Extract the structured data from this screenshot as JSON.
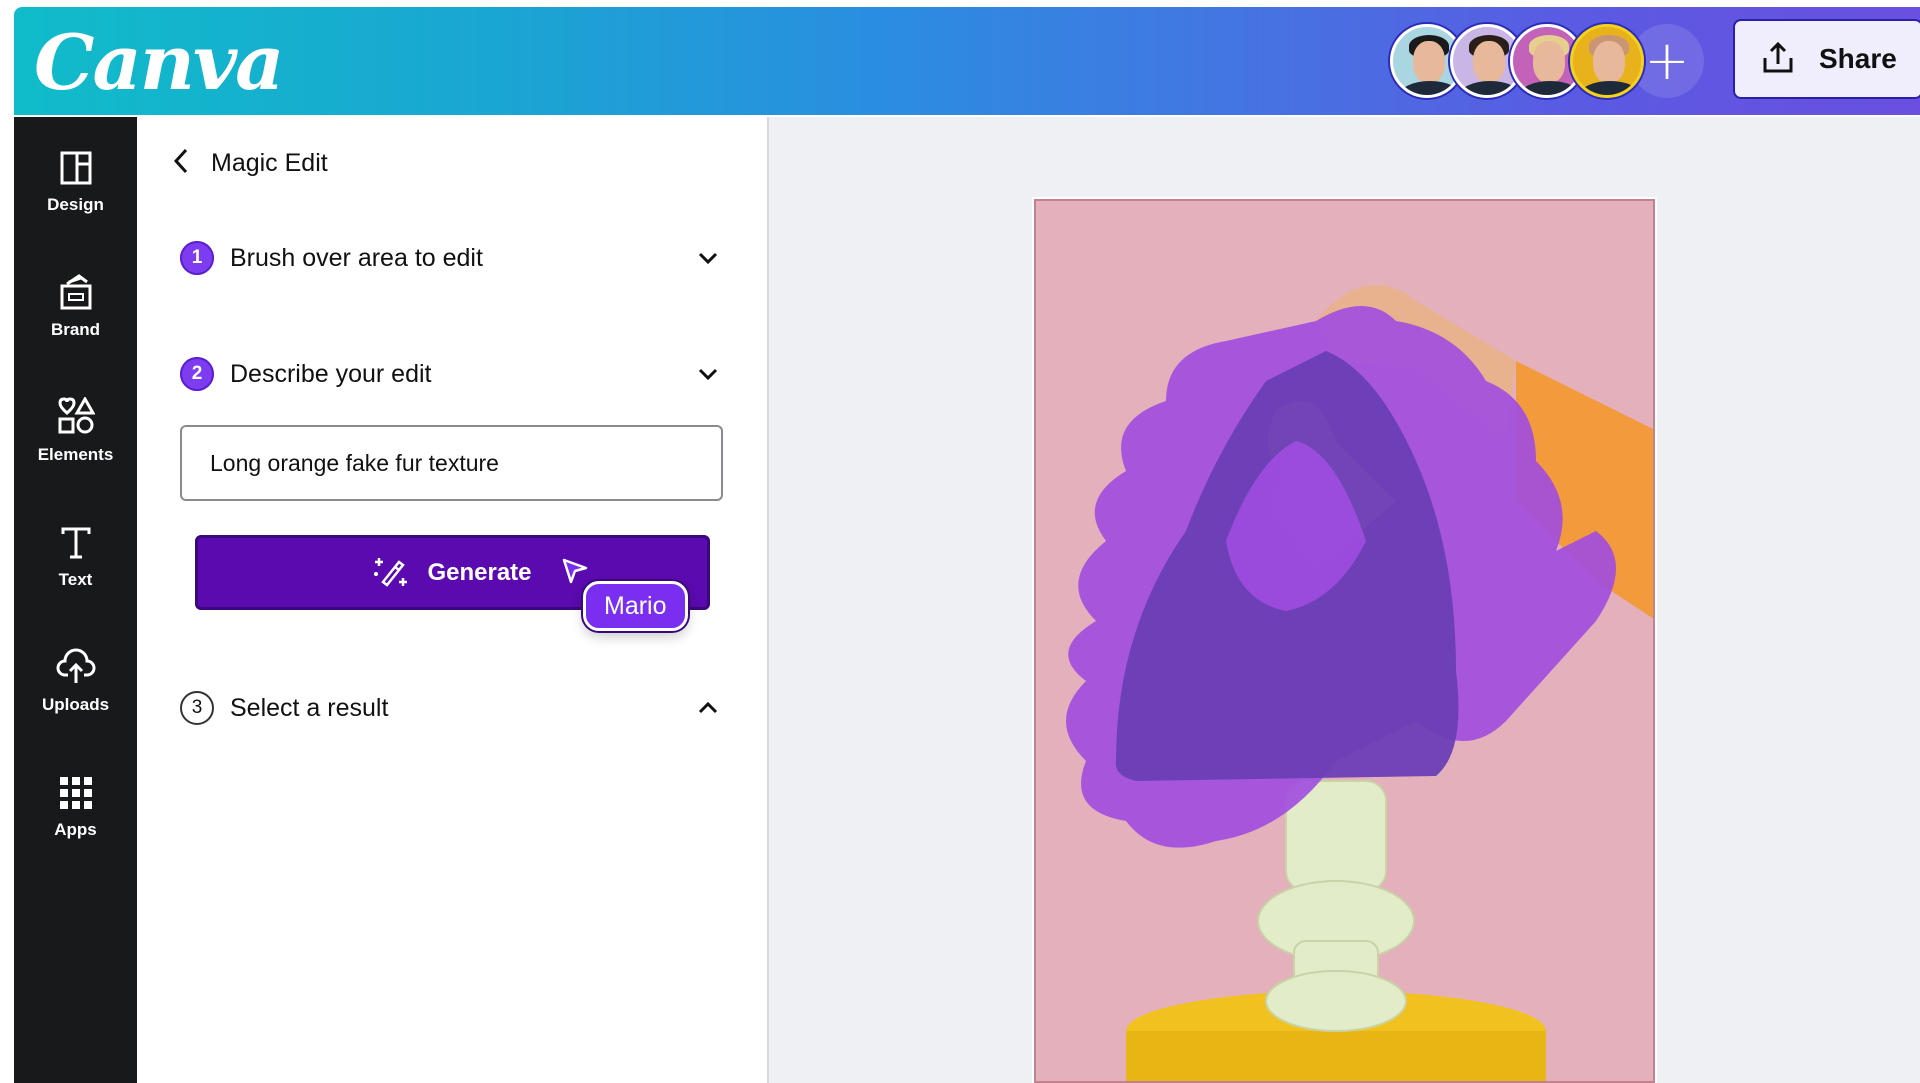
{
  "app": {
    "logo_text": "Canva"
  },
  "header": {
    "collaborators": [
      {
        "name": "collaborator-1",
        "bg": "#a9d6e0",
        "hair": "#1a1a1a",
        "ring": "#ffffff"
      },
      {
        "name": "collaborator-2",
        "bg": "#c9b6e6",
        "hair": "#2a1e18",
        "ring": "#ffffff"
      },
      {
        "name": "collaborator-3",
        "bg": "#c262b8",
        "hair": "#e6cf8e",
        "ring": "#ffffff"
      },
      {
        "name": "collaborator-4",
        "bg": "#e7b21c",
        "hair": "#c99574",
        "ring": "#f5d21a"
      }
    ],
    "add_collaborator_symbol": "+",
    "share_label": "Share"
  },
  "sidebar": {
    "items": [
      {
        "id": "design",
        "label": "Design",
        "icon": "layout-icon"
      },
      {
        "id": "brand",
        "label": "Brand",
        "icon": "brand-kit-icon"
      },
      {
        "id": "elements",
        "label": "Elements",
        "icon": "shapes-icon"
      },
      {
        "id": "text",
        "label": "Text",
        "icon": "text-icon"
      },
      {
        "id": "uploads",
        "label": "Uploads",
        "icon": "cloud-upload-icon"
      },
      {
        "id": "apps",
        "label": "Apps",
        "icon": "apps-grid-icon"
      }
    ]
  },
  "panel": {
    "title": "Magic Edit",
    "steps": [
      {
        "number": "1",
        "label": "Brush over area to edit",
        "state": "active",
        "expanded": false
      },
      {
        "number": "2",
        "label": "Describe your edit",
        "state": "active",
        "expanded": true
      },
      {
        "number": "3",
        "label": "Select a result",
        "state": "idle",
        "expanded": false
      }
    ],
    "prompt_value": "Long orange fake fur texture",
    "generate_label": "Generate",
    "cursor_user": "Mario"
  },
  "colors": {
    "accent": "#7d3cf0",
    "generate_bg": "#5a0aae",
    "brush_mask": "#a04ce0",
    "page_bg": "#e3b0bb"
  }
}
